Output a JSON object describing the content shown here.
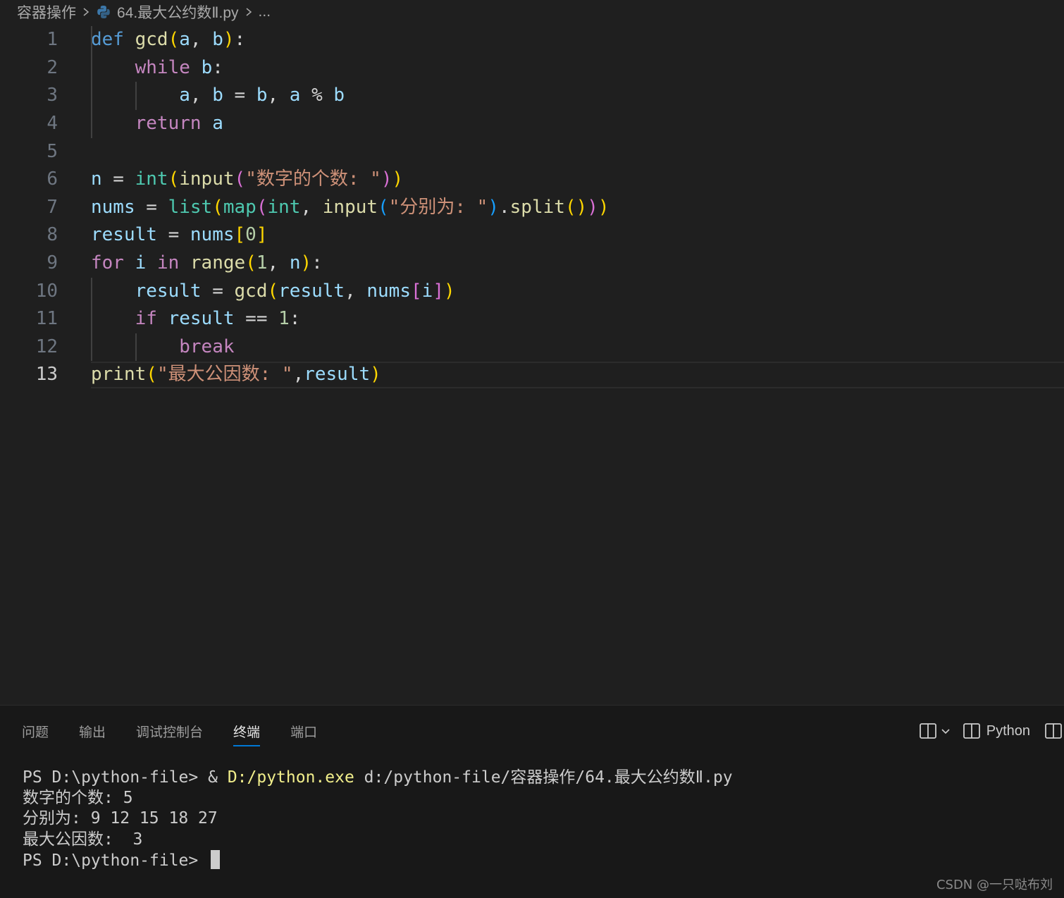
{
  "breadcrumb": {
    "folder": "容器操作",
    "file": "64.最大公约数Ⅱ.py",
    "more": "..."
  },
  "editor": {
    "active_line": 13,
    "lines": [
      {
        "num": "1",
        "tokens": [
          [
            "kw-blue",
            "def"
          ],
          [
            "op",
            " "
          ],
          [
            "fn",
            "gcd"
          ],
          [
            "p1",
            "("
          ],
          [
            "var",
            "a"
          ],
          [
            "op",
            ", "
          ],
          [
            "var",
            "b"
          ],
          [
            "p1",
            ")"
          ],
          [
            "op",
            ":"
          ]
        ]
      },
      {
        "num": "2",
        "tokens": [
          [
            "op",
            "    "
          ],
          [
            "kw-purple",
            "while"
          ],
          [
            "op",
            " "
          ],
          [
            "var",
            "b"
          ],
          [
            "op",
            ":"
          ]
        ]
      },
      {
        "num": "3",
        "tokens": [
          [
            "op",
            "        "
          ],
          [
            "var",
            "a"
          ],
          [
            "op",
            ", "
          ],
          [
            "var",
            "b"
          ],
          [
            "op",
            " = "
          ],
          [
            "var",
            "b"
          ],
          [
            "op",
            ", "
          ],
          [
            "var",
            "a"
          ],
          [
            "op",
            " % "
          ],
          [
            "var",
            "b"
          ]
        ]
      },
      {
        "num": "4",
        "tokens": [
          [
            "op",
            "    "
          ],
          [
            "kw-purple",
            "return"
          ],
          [
            "op",
            " "
          ],
          [
            "var",
            "a"
          ]
        ]
      },
      {
        "num": "5",
        "tokens": []
      },
      {
        "num": "6",
        "tokens": [
          [
            "var",
            "n"
          ],
          [
            "op",
            " = "
          ],
          [
            "builtin",
            "int"
          ],
          [
            "p1",
            "("
          ],
          [
            "fn",
            "input"
          ],
          [
            "p2",
            "("
          ],
          [
            "str",
            "\"数字的个数: \""
          ],
          [
            "p2",
            ")"
          ],
          [
            "p1",
            ")"
          ]
        ]
      },
      {
        "num": "7",
        "tokens": [
          [
            "var",
            "nums"
          ],
          [
            "op",
            " = "
          ],
          [
            "builtin",
            "list"
          ],
          [
            "p1",
            "("
          ],
          [
            "builtin",
            "map"
          ],
          [
            "p2",
            "("
          ],
          [
            "builtin",
            "int"
          ],
          [
            "op",
            ", "
          ],
          [
            "fn",
            "input"
          ],
          [
            "p3",
            "("
          ],
          [
            "str",
            "\"分别为: \""
          ],
          [
            "p3",
            ")"
          ],
          [
            "op",
            "."
          ],
          [
            "fn",
            "split"
          ],
          [
            "p1",
            "("
          ],
          [
            "p1",
            ")"
          ],
          [
            "p2",
            ")"
          ],
          [
            "p1",
            ")"
          ]
        ]
      },
      {
        "num": "8",
        "tokens": [
          [
            "var",
            "result"
          ],
          [
            "op",
            " = "
          ],
          [
            "var",
            "nums"
          ],
          [
            "p1",
            "["
          ],
          [
            "num",
            "0"
          ],
          [
            "p1",
            "]"
          ]
        ]
      },
      {
        "num": "9",
        "tokens": [
          [
            "kw-purple",
            "for"
          ],
          [
            "op",
            " "
          ],
          [
            "var",
            "i"
          ],
          [
            "op",
            " "
          ],
          [
            "kw-purple",
            "in"
          ],
          [
            "op",
            " "
          ],
          [
            "fn",
            "range"
          ],
          [
            "p1",
            "("
          ],
          [
            "num",
            "1"
          ],
          [
            "op",
            ", "
          ],
          [
            "var",
            "n"
          ],
          [
            "p1",
            ")"
          ],
          [
            "op",
            ":"
          ]
        ]
      },
      {
        "num": "10",
        "tokens": [
          [
            "op",
            "    "
          ],
          [
            "var",
            "result"
          ],
          [
            "op",
            " = "
          ],
          [
            "fn",
            "gcd"
          ],
          [
            "p1",
            "("
          ],
          [
            "var",
            "result"
          ],
          [
            "op",
            ", "
          ],
          [
            "var",
            "nums"
          ],
          [
            "p2",
            "["
          ],
          [
            "var",
            "i"
          ],
          [
            "p2",
            "]"
          ],
          [
            "p1",
            ")"
          ]
        ]
      },
      {
        "num": "11",
        "tokens": [
          [
            "op",
            "    "
          ],
          [
            "kw-purple",
            "if"
          ],
          [
            "op",
            " "
          ],
          [
            "var",
            "result"
          ],
          [
            "op",
            " == "
          ],
          [
            "num",
            "1"
          ],
          [
            "op",
            ":"
          ]
        ]
      },
      {
        "num": "12",
        "tokens": [
          [
            "op",
            "        "
          ],
          [
            "kw-purple",
            "break"
          ]
        ]
      },
      {
        "num": "13",
        "tokens": [
          [
            "fn",
            "print"
          ],
          [
            "p1",
            "("
          ],
          [
            "str",
            "\"最大公因数: \""
          ],
          [
            "op",
            ","
          ],
          [
            "var",
            "result"
          ],
          [
            "p1",
            ")"
          ]
        ]
      }
    ]
  },
  "panel": {
    "tabs": [
      {
        "label": "问题",
        "name": "tab-problems",
        "active": false
      },
      {
        "label": "输出",
        "name": "tab-output",
        "active": false
      },
      {
        "label": "调试控制台",
        "name": "tab-debug-console",
        "active": false
      },
      {
        "label": "终端",
        "name": "tab-terminal",
        "active": true
      },
      {
        "label": "端口",
        "name": "tab-ports",
        "active": false
      }
    ],
    "terminal_profile": "Python",
    "icons": {
      "split": "split-terminal-icon",
      "dropdown": "chevron-down-icon",
      "profile": "terminal-split-icon",
      "maximize": "panel-layout-icon"
    }
  },
  "terminal": {
    "line1_prompt": "PS D:\\python-file> ",
    "line1_amp": "& ",
    "line1_exe": "D:/python.exe",
    "line1_arg": " d:/python-file/容器操作/64.最大公约数Ⅱ.py",
    "line2": "数字的个数: 5",
    "line3": "分别为: 9 12 15 18 27",
    "line4": "最大公因数:  3",
    "line5_prompt": "PS D:\\python-file> "
  },
  "watermark": "CSDN @一只哒布刘",
  "colors": {
    "editor_bg": "#1f1f1f",
    "panel_bg": "#181818",
    "active_tab_underline": "#0078d4"
  }
}
